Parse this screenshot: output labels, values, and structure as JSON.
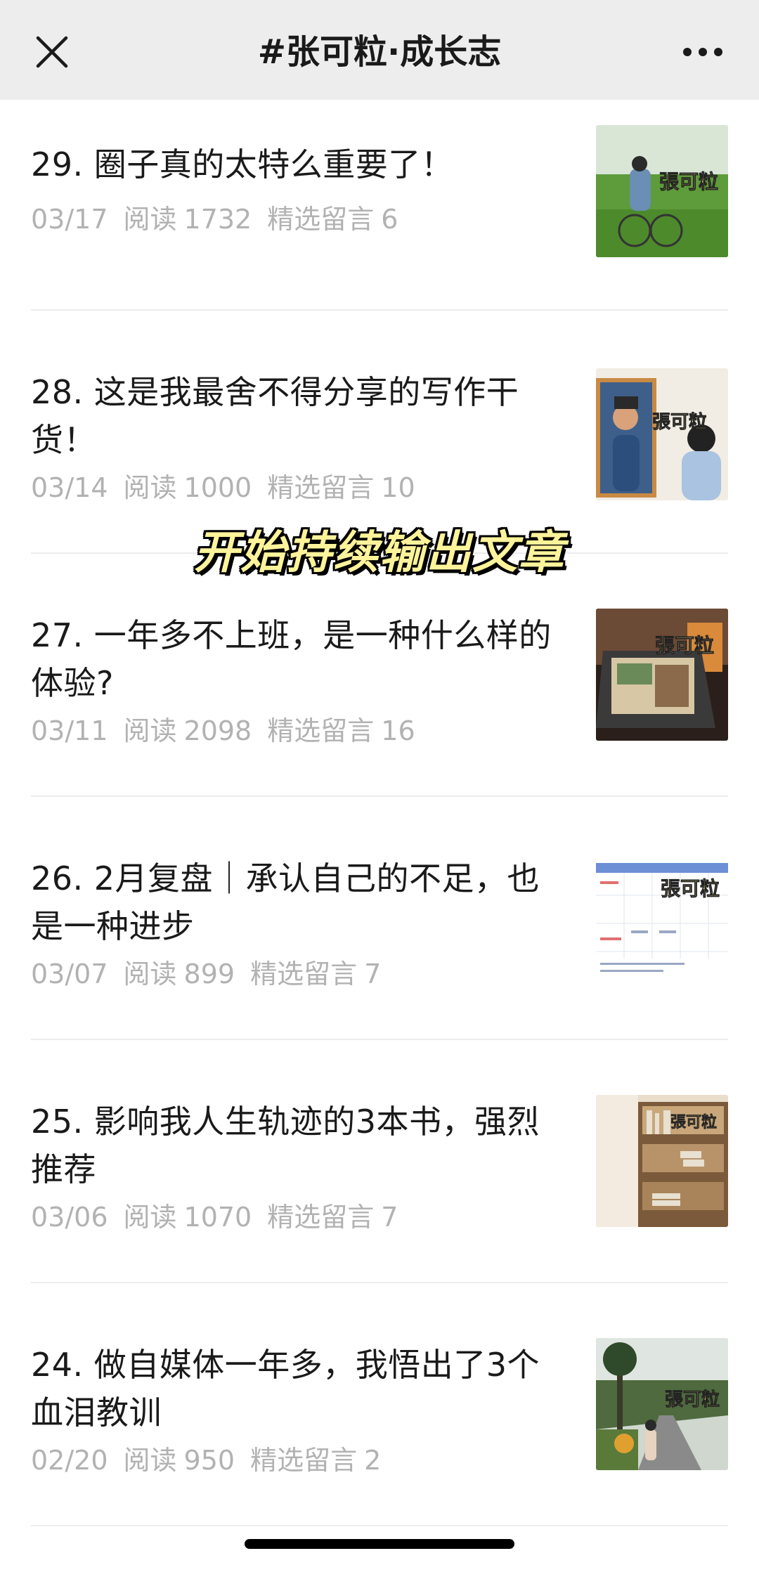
{
  "header": {
    "title": "#张可粒·成长志",
    "close_icon": "close-icon",
    "more_icon": "more-icon"
  },
  "watermark": "張可粒",
  "overlay_caption": "开始持续输出文章",
  "meta_labels": {
    "read": "阅读",
    "comments": "精选留言"
  },
  "articles": [
    {
      "title": "29. 圈子真的太特么重要了！",
      "date": "03/17",
      "reads": "1732",
      "comments": "6",
      "thumb": "girl-bicycle-field"
    },
    {
      "title": "28. 这是我最舍不得分享的写作干货！",
      "date": "03/14",
      "reads": "1000",
      "comments": "10",
      "thumb": "woman-painting"
    },
    {
      "title": "27. 一年多不上班，是一种什么样的体验?",
      "date": "03/11",
      "reads": "2098",
      "comments": "16",
      "thumb": "laptop-shop"
    },
    {
      "title": "26. 2月复盘｜承认自己的不足，也是一种进步",
      "date": "03/07",
      "reads": "899",
      "comments": "7",
      "thumb": "calendar-screenshot"
    },
    {
      "title": "25. 影响我人生轨迹的3本书，强烈推荐",
      "date": "03/06",
      "reads": "1070",
      "comments": "7",
      "thumb": "bookshelf"
    },
    {
      "title": "24. 做自媒体一年多，我悟出了3个血泪教训",
      "date": "02/20",
      "reads": "950",
      "comments": "2",
      "thumb": "woman-park-road"
    }
  ],
  "colors": {
    "header_bg": "#ededed",
    "title_text": "#1a1a1a",
    "meta_text": "#b2b2b2",
    "divider": "#ececec",
    "caption_fill": "#fdf39a"
  }
}
